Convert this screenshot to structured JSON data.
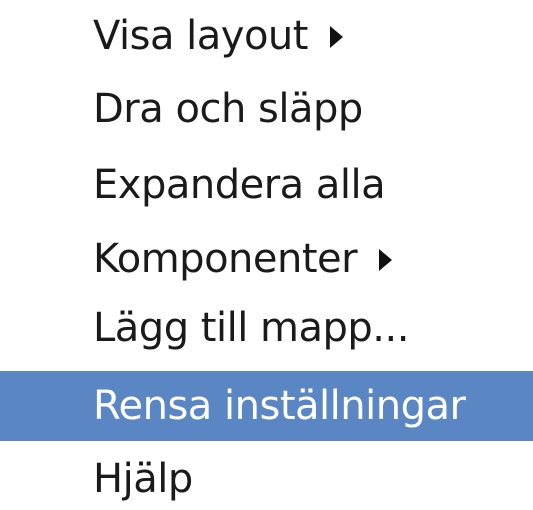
{
  "context_menu": {
    "items": [
      {
        "label": "Visa layout",
        "submenu": true,
        "selected": false
      },
      {
        "label": "Dra och släpp",
        "submenu": false,
        "selected": false
      },
      {
        "label": "Expandera alla",
        "submenu": false,
        "selected": false
      },
      {
        "label": "Komponenter",
        "submenu": true,
        "selected": false
      },
      {
        "label": "Lägg till mapp...",
        "submenu": false,
        "selected": false
      },
      {
        "label": "Rensa inställningar",
        "submenu": false,
        "selected": true
      },
      {
        "label": "Hjälp",
        "submenu": false,
        "selected": false
      }
    ],
    "submenu_icon": "triangle-right-icon",
    "colors": {
      "selection_background": "#5b86c4",
      "selection_text": "#ffffff",
      "text": "#1a1a1a"
    }
  }
}
